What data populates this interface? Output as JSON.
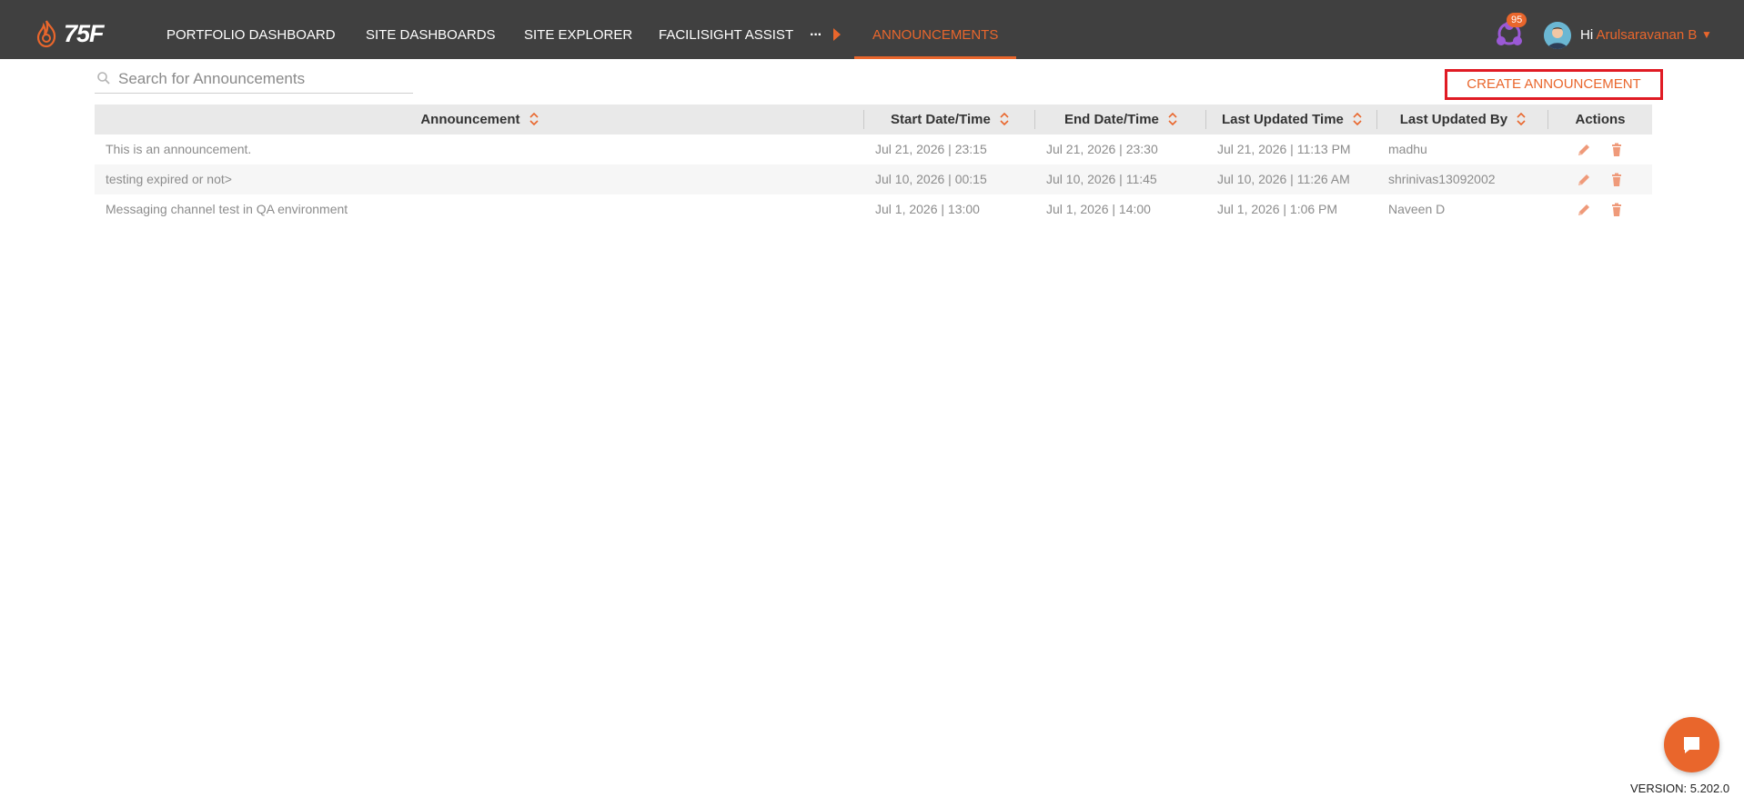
{
  "brand": {
    "logo_text": "75F",
    "accent": "#e9662c",
    "highlight": "#e01b24"
  },
  "nav": {
    "items": [
      "PORTFOLIO DASHBOARD",
      "SITE DASHBOARDS",
      "SITE EXPLORER",
      "FACILISIGHT ASSIST"
    ],
    "more": "···",
    "active": "ANNOUNCEMENTS"
  },
  "user": {
    "notification_count": "95",
    "greeting": "Hi",
    "name": "Arulsaravanan B"
  },
  "search": {
    "placeholder": "Search for Announcements"
  },
  "create_button": "CREATE ANNOUNCEMENT",
  "table": {
    "columns": [
      "Announcement",
      "Start Date/Time",
      "End Date/Time",
      "Last Updated Time",
      "Last Updated By",
      "Actions"
    ],
    "rows": [
      {
        "announcement": "This is an announcement.",
        "start": "Jul 21, 2026 | 23:15",
        "end": "Jul 21, 2026 | 23:30",
        "updated": "Jul 21, 2026 | 11:13 PM",
        "by": "madhu"
      },
      {
        "announcement": "testing expired or not>",
        "start": "Jul 10, 2026 | 00:15",
        "end": "Jul 10, 2026 | 11:45",
        "updated": "Jul 10, 2026 | 11:26 AM",
        "by": "shrinivas13092002"
      },
      {
        "announcement": "Messaging channel test in QA environment",
        "start": "Jul 1, 2026 | 13:00",
        "end": "Jul 1, 2026 | 14:00",
        "updated": "Jul 1, 2026 | 1:06 PM",
        "by": "Naveen D"
      }
    ]
  },
  "version": "VERSION: 5.202.0"
}
